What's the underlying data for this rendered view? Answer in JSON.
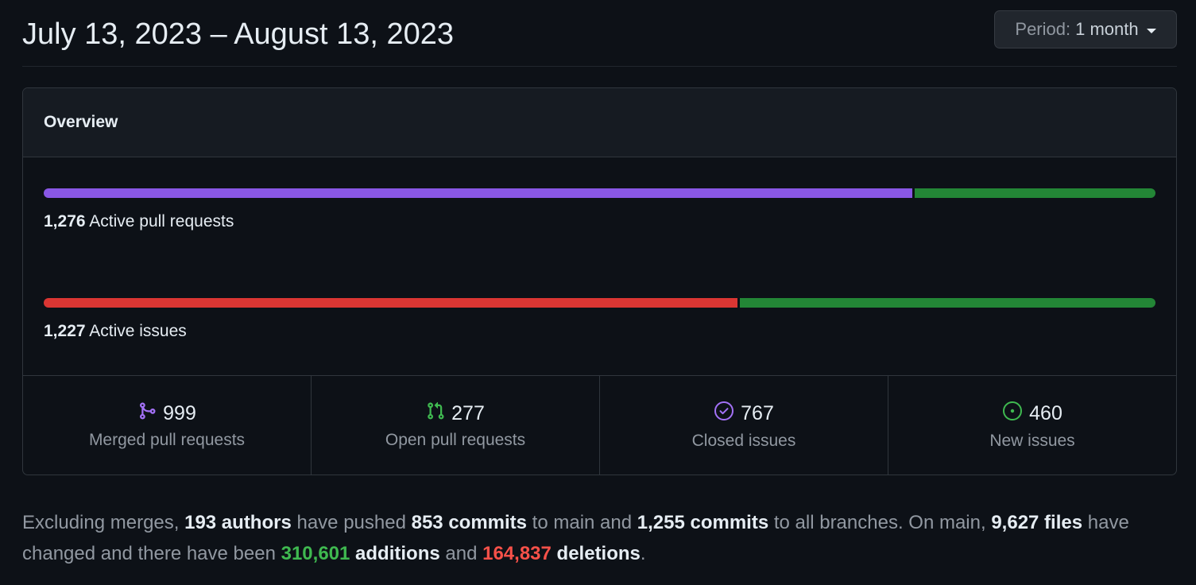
{
  "header": {
    "date_range": "July 13, 2023 – August 13, 2023",
    "period_label": "Period:",
    "period_value": "1 month"
  },
  "overview": {
    "title": "Overview",
    "pull_requests": {
      "count": "1,276",
      "label": "Active pull requests",
      "merged_fraction": 0.783,
      "colors": {
        "merged": "#8957e5",
        "open": "#238636"
      }
    },
    "issues": {
      "count": "1,227",
      "label": "Active issues",
      "closed_fraction": 0.625,
      "colors": {
        "closed": "#da3633",
        "new": "#238636"
      }
    },
    "stats": [
      {
        "icon": "git-merge-icon",
        "value": "999",
        "label": "Merged pull requests",
        "color": "#a371f7"
      },
      {
        "icon": "git-pull-request-icon",
        "value": "277",
        "label": "Open pull requests",
        "color": "#3fb950"
      },
      {
        "icon": "issue-closed-icon",
        "value": "767",
        "label": "Closed issues",
        "color": "#a371f7"
      },
      {
        "icon": "issue-opened-icon",
        "value": "460",
        "label": "New issues",
        "color": "#3fb950"
      }
    ]
  },
  "summary": {
    "t1": "Excluding merges, ",
    "authors": "193 authors",
    "t2": " have pushed ",
    "main_commits": "853 commits",
    "t3": " to main and ",
    "all_commits": "1,255 commits",
    "t4": " to all branches. On main, ",
    "files": "9,627 files",
    "t5": " have changed and there have been ",
    "additions_num": "310,601",
    "additions_word": " additions",
    "t6": " and ",
    "deletions_num": "164,837",
    "deletions_word": " deletions",
    "t7": "."
  }
}
